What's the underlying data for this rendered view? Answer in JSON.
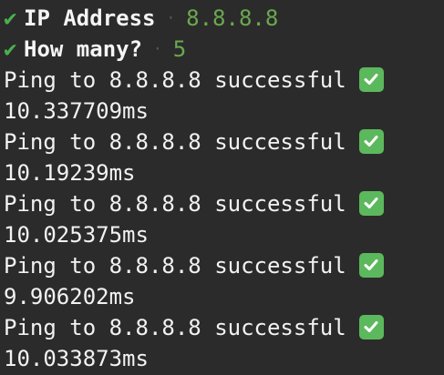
{
  "prompts": [
    {
      "question": "IP Address",
      "answer": "8.8.8.8",
      "separator": "·"
    },
    {
      "question": "How many?",
      "answer": "5",
      "separator": "·"
    }
  ],
  "check_symbol": "✔",
  "results": [
    {
      "message": "Ping to 8.8.8.8 successful",
      "latency": "10.337709ms",
      "status_icon": "check-mark-button-icon"
    },
    {
      "message": "Ping to 8.8.8.8 successful",
      "latency": "10.19239ms",
      "status_icon": "check-mark-button-icon"
    },
    {
      "message": "Ping to 8.8.8.8 successful",
      "latency": "10.025375ms",
      "status_icon": "check-mark-button-icon"
    },
    {
      "message": "Ping to 8.8.8.8 successful",
      "latency": "9.906202ms",
      "status_icon": "check-mark-button-icon"
    },
    {
      "message": "Ping to 8.8.8.8 successful",
      "latency": "10.033873ms",
      "status_icon": "check-mark-button-icon"
    }
  ],
  "colors": {
    "background": "#2b2b2b",
    "text": "#f2f2f2",
    "check": "#4caf50",
    "answer": "#6aa84f",
    "badge": "#5cb85c"
  }
}
